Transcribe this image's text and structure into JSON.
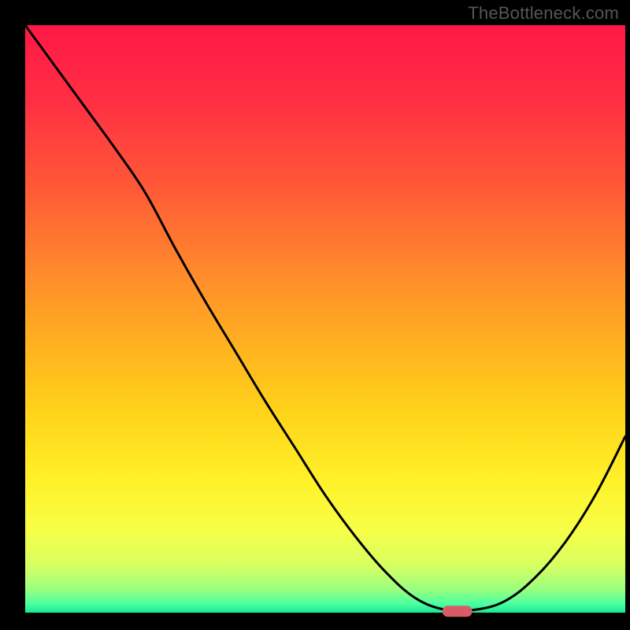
{
  "watermark": "TheBottleneck.com",
  "chart_data": {
    "type": "line",
    "title": "",
    "xlabel": "",
    "ylabel": "",
    "xlim": [
      0,
      100
    ],
    "ylim": [
      0,
      100
    ],
    "x": [
      0,
      5,
      10,
      15,
      20,
      25,
      30,
      35,
      40,
      45,
      50,
      55,
      60,
      65,
      70,
      75,
      80,
      85,
      90,
      95,
      100
    ],
    "values": [
      100,
      93,
      86,
      79,
      71.5,
      62,
      53,
      44.5,
      36,
      28,
      20,
      13,
      7,
      2.5,
      0.5,
      0.5,
      2,
      6,
      12,
      20,
      30
    ],
    "optimum_x": 72,
    "background_gradient_stops": [
      {
        "offset": 0.0,
        "color": "#ff1846"
      },
      {
        "offset": 0.13,
        "color": "#ff2f43"
      },
      {
        "offset": 0.28,
        "color": "#ff5a36"
      },
      {
        "offset": 0.42,
        "color": "#ff8a2c"
      },
      {
        "offset": 0.55,
        "color": "#ffb31f"
      },
      {
        "offset": 0.67,
        "color": "#ffd61a"
      },
      {
        "offset": 0.78,
        "color": "#fff22a"
      },
      {
        "offset": 0.86,
        "color": "#f7ff47"
      },
      {
        "offset": 0.92,
        "color": "#d6ff62"
      },
      {
        "offset": 0.96,
        "color": "#9bff7e"
      },
      {
        "offset": 0.985,
        "color": "#4cffa0"
      },
      {
        "offset": 1.0,
        "color": "#16e893"
      }
    ],
    "marker": {
      "color": "#d85c67",
      "x": 72,
      "y": 0.5
    }
  },
  "frame": {
    "inner_left": 32,
    "inner_top": 32,
    "inner_right": 794,
    "inner_bottom": 778
  }
}
